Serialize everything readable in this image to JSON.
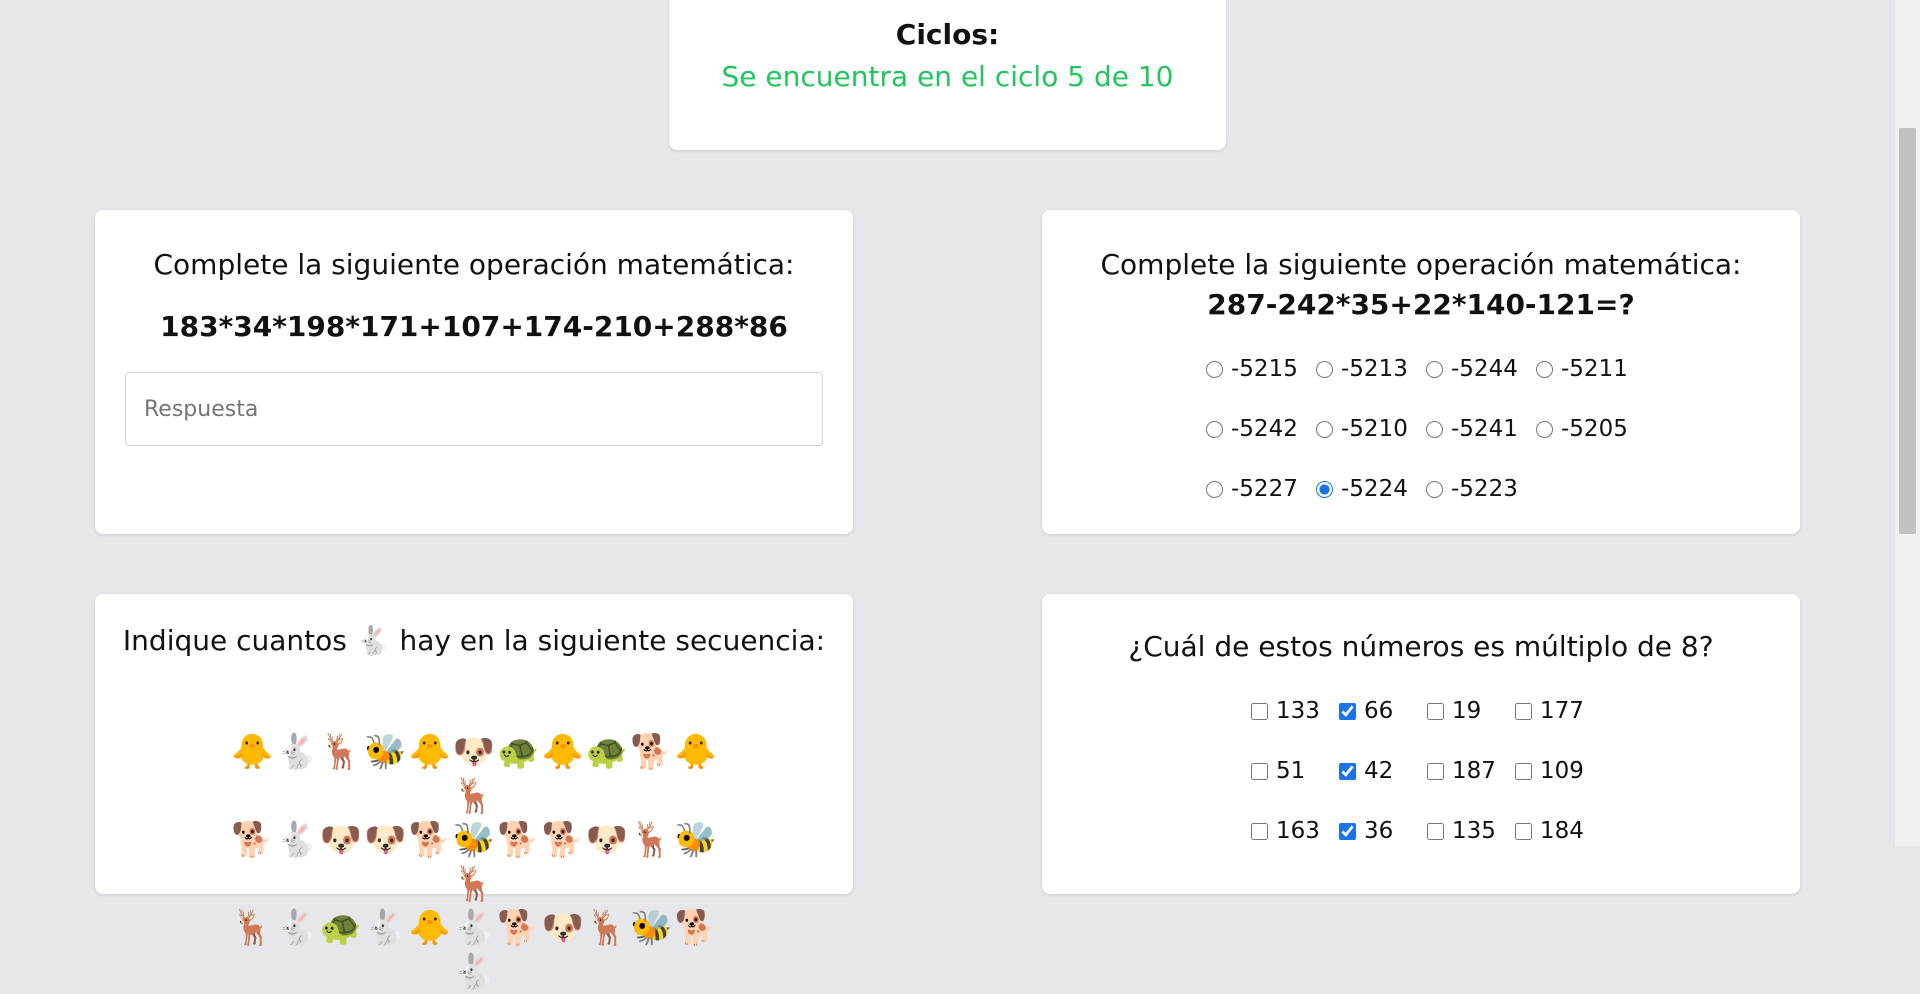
{
  "cycles": {
    "title": "Ciclos:",
    "status": "Se encuentra en el ciclo 5 de 10",
    "status_color": "#22c55e"
  },
  "q1": {
    "prompt": "Complete la siguiente operación matemática:",
    "expression": "183*34*198*171+107+174-210+288*86",
    "answer_placeholder": "Respuesta",
    "answer_value": ""
  },
  "q2": {
    "prompt": "Complete la siguiente operación matemática:",
    "expression": "287-242*35+22*140-121=?",
    "options": [
      "-5215",
      "-5213",
      "-5244",
      "-5211",
      "-5242",
      "-5210",
      "-5241",
      "-5205",
      "-5227",
      "-5224",
      "-5223"
    ],
    "selected": "-5224"
  },
  "q3": {
    "prompt": "Indique cuantos 🐇 hay en la siguiente secuencia:",
    "sequence": [
      "🐥🐇🦌🐝🐥🐶🐢🐥🐢🐕🐥🦌",
      "🐕🐇🐶🐶🐕🐝🐕🐕🐶🦌🐝🦌",
      "🦌🐇🐢🐇🐥🐇🐕🐶🦌🐝🐕🐇"
    ]
  },
  "q4": {
    "prompt": "¿Cuál de estos números es múltiplo de 8?",
    "options": [
      "133",
      "66",
      "19",
      "177",
      "51",
      "42",
      "187",
      "109",
      "163",
      "36",
      "135",
      "184"
    ],
    "checked": [
      "66",
      "42",
      "36"
    ]
  },
  "accent": "#1a73e8"
}
